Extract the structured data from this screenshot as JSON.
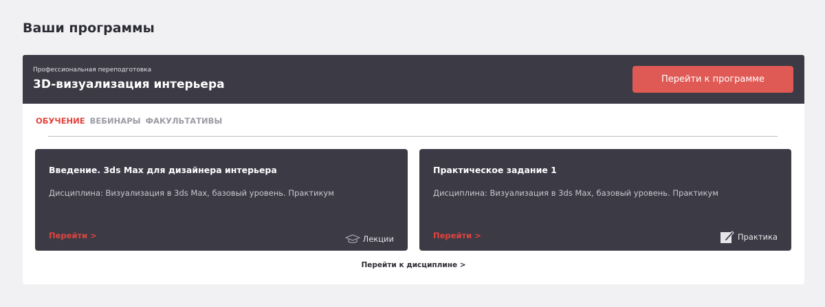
{
  "page_title": "Ваши программы",
  "program": {
    "subtitle": "Профессиональная переподготовка",
    "title": "3D-визуализация интерьера",
    "button": "Перейти к программе"
  },
  "tabs": [
    {
      "label": "ОБУЧЕНИЕ",
      "active": true
    },
    {
      "label": "ВЕБИНАРЫ"
    },
    {
      "label": "ФАКУЛЬТАТИВЫ"
    }
  ],
  "cards": [
    {
      "title": "Введение. 3ds Max для дизайнера интерьера",
      "discipline": "Дисциплина: Визуализация в 3ds Max, базовый уровень. Практикум",
      "link": "Перейти >",
      "type": "Лекции",
      "icon": "graduation-cap-icon"
    },
    {
      "title": "Практическое задание 1",
      "discipline": "Дисциплина: Визуализация в 3ds Max, базовый уровень. Практикум",
      "link": "Перейти >",
      "type": "Практика",
      "icon": "edit-icon"
    }
  ],
  "discipline_link": "Перейти к дисциплине >"
}
